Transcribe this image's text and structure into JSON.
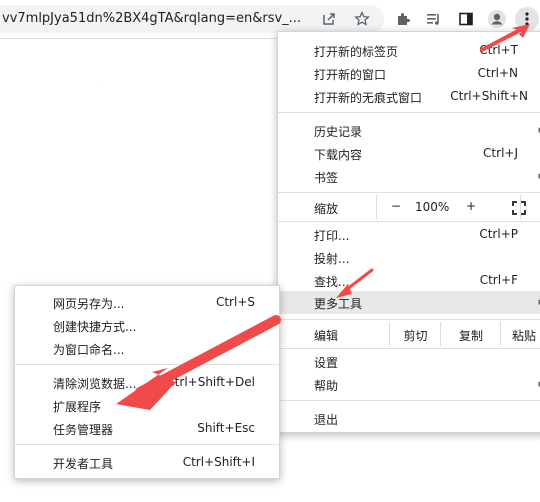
{
  "omnibox": {
    "url": "vv7mlpJya51dn%2BX4gTA&rqlang=en&rsv_..."
  },
  "toolbar_icons": [
    "share-icon",
    "star-icon",
    "extensions-icon",
    "media-icon",
    "sidepanel-icon",
    "profile-icon",
    "kebab-menu-icon"
  ],
  "main_menu": {
    "new_tab": {
      "label": "打开新的标签页",
      "shortcut": "Ctrl+T"
    },
    "new_window": {
      "label": "打开新的窗口",
      "shortcut": "Ctrl+N"
    },
    "new_incognito": {
      "label": "打开新的无痕式窗口",
      "shortcut": "Ctrl+Shift+N"
    },
    "history": {
      "label": "历史记录"
    },
    "downloads": {
      "label": "下载内容",
      "shortcut": "Ctrl+J"
    },
    "bookmarks": {
      "label": "书签"
    },
    "zoom": {
      "label": "缩放",
      "minus": "−",
      "value": "100%",
      "plus": "+"
    },
    "print": {
      "label": "打印...",
      "shortcut": "Ctrl+P"
    },
    "cast": {
      "label": "投射..."
    },
    "find": {
      "label": "查找...",
      "shortcut": "Ctrl+F"
    },
    "more_tools": {
      "label": "更多工具"
    },
    "edit": {
      "label": "编辑",
      "cut": "剪切",
      "copy": "复制",
      "paste": "粘贴"
    },
    "settings": {
      "label": "设置"
    },
    "help": {
      "label": "帮助"
    },
    "exit": {
      "label": "退出"
    }
  },
  "sub_menu": {
    "save_page": {
      "label": "网页另存为...",
      "shortcut": "Ctrl+S"
    },
    "create_shortcut": {
      "label": "创建快捷方式..."
    },
    "name_window": {
      "label": "为窗口命名..."
    },
    "clear_data": {
      "label": "清除浏览数据...",
      "shortcut": "Ctrl+Shift+Del"
    },
    "extensions": {
      "label": "扩展程序"
    },
    "task_manager": {
      "label": "任务管理器",
      "shortcut": "Shift+Esc"
    },
    "devtools": {
      "label": "开发者工具",
      "shortcut": "Ctrl+Shift+I"
    }
  },
  "colors": {
    "arrow": "#f04a4a",
    "highlight": "#e8e8e8",
    "omnibox": "#f1f3f4"
  }
}
